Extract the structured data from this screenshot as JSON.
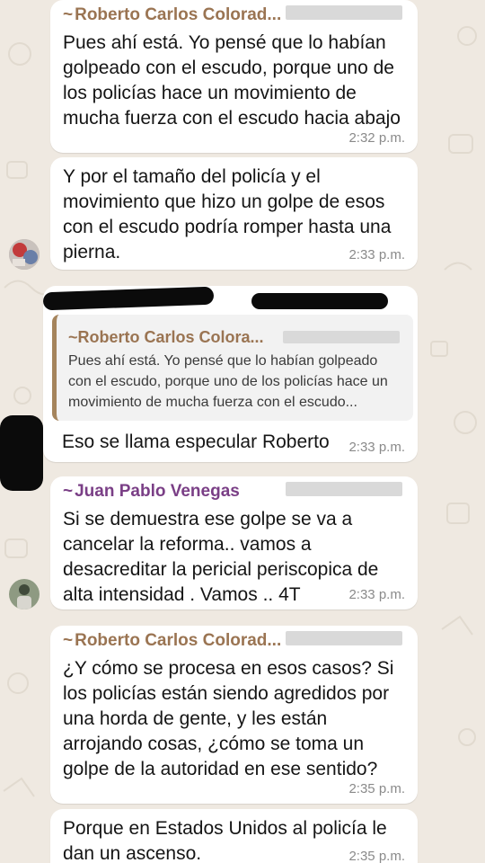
{
  "messages": [
    {
      "sender": "Roberto Carlos Colorad...",
      "sender_prefix": "~",
      "text": "Pues ahí está. Yo pensé que lo habían golpeado con el escudo, porque uno de los policías hace un movimiento de mucha fuerza con el escudo hacia abajo",
      "time": "2:32 p.m."
    },
    {
      "text": "Y por el tamaño del policía y el movimiento que hizo un golpe de esos con el escudo podría romper hasta una pierna.",
      "time": "2:33 p.m."
    },
    {
      "quoted": {
        "sender": "Roberto Carlos Colora...",
        "sender_prefix": "~",
        "text": "Pues ahí está. Yo pensé que lo habían golpeado con el escudo, porque uno de los policías hace un movimiento de mucha fuerza con el escudo..."
      },
      "text": "Eso se llama especular Roberto",
      "time": "2:33 p.m."
    },
    {
      "sender": "Juan Pablo Venegas",
      "sender_prefix": "~",
      "text": "Si se demuestra ese golpe se va a cancelar la reforma.. vamos a desacreditar la pericial periscopica de alta intensidad . Vamos .. 4T",
      "time": "2:33 p.m."
    },
    {
      "sender": "Roberto Carlos Colorad...",
      "sender_prefix": "~",
      "text": "¿Y cómo se procesa en esos casos? Si los policías están siendo agredidos por una horda de gente, y les están arrojando cosas, ¿cómo se toma un golpe de la autoridad en ese sentido?",
      "time": "2:35 p.m."
    },
    {
      "text": "Porque en Estados Unidos al policía le dan un ascenso.",
      "time": "2:35 p.m."
    }
  ],
  "colors": {
    "roberto_name": "#9a7452",
    "juan_name": "#7a3f86",
    "bubble": "#ffffff",
    "timestamp": "#8a8a8a",
    "chat_background": "#efe9e1",
    "quote_bar": "#a5845c"
  }
}
